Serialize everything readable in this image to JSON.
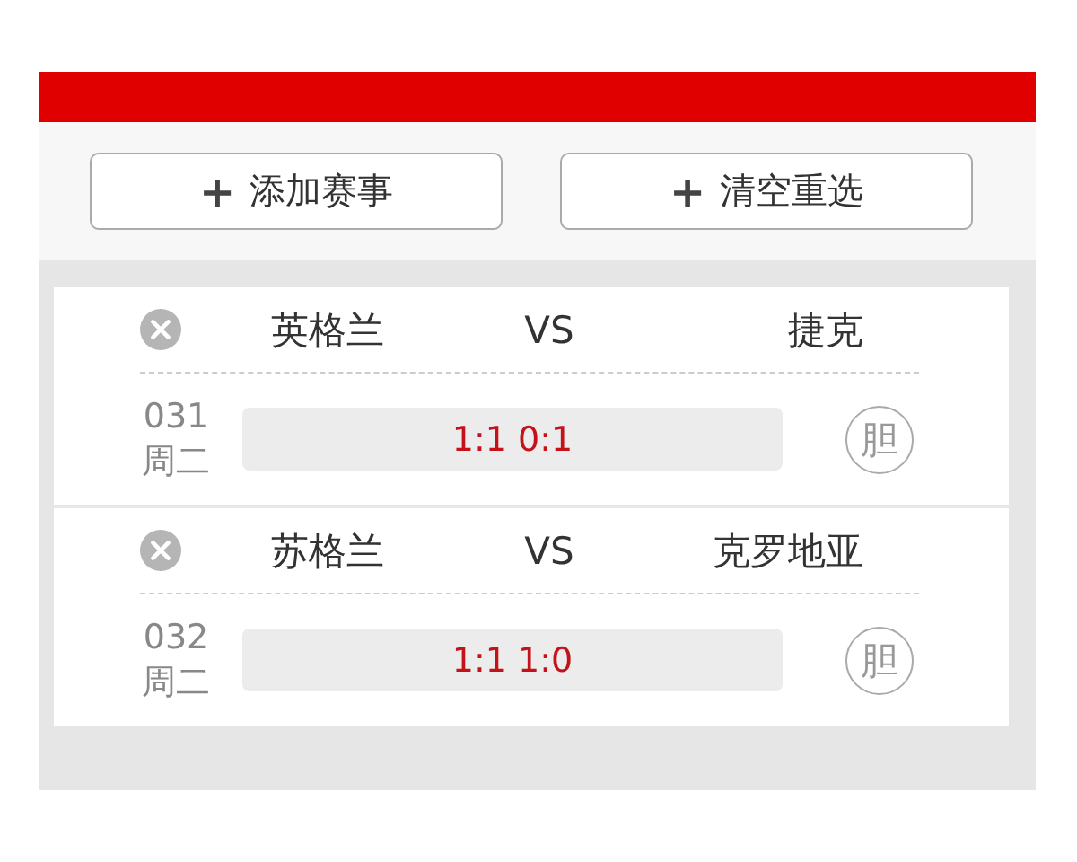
{
  "actions": [
    {
      "label": "添加赛事",
      "icon": "+"
    },
    {
      "label": "清空重选",
      "icon": "+"
    }
  ],
  "matches": [
    {
      "home": "英格兰",
      "vs": "VS",
      "away": "捷克",
      "number": "031",
      "day": "周二",
      "selection": "1:1 0:1",
      "banker": {
        "label": "胆",
        "selected": false
      }
    },
    {
      "home": "苏格兰",
      "vs": "VS",
      "away": "克罗地亚",
      "number": "032",
      "day": "周二",
      "selection": "1:1 1:0",
      "banker": {
        "label": "胆",
        "selected": false
      }
    }
  ]
}
